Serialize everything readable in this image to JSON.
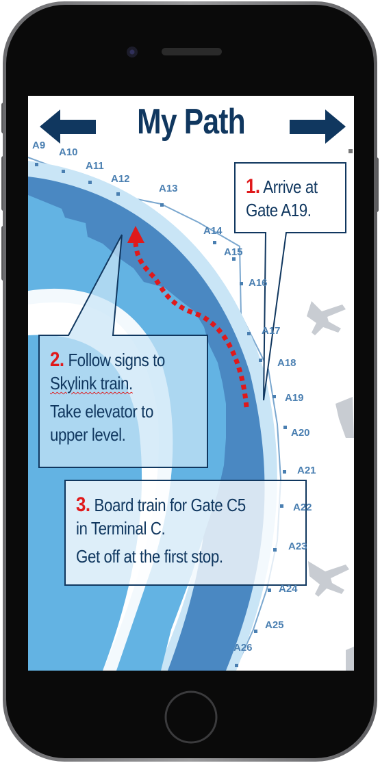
{
  "screen": {
    "title": "My Path",
    "nav": {
      "back": "left-arrow-icon",
      "forward": "right-arrow-icon"
    },
    "gates": [
      "A9",
      "A10",
      "A11",
      "A12",
      "A13",
      "A14",
      "A15",
      "A16",
      "A17",
      "A18",
      "A19",
      "A20",
      "A21",
      "A22",
      "A23",
      "A24",
      "A25",
      "A26"
    ],
    "steps": [
      {
        "number": "1.",
        "lines": [
          "Arrive at",
          "Gate A19."
        ]
      },
      {
        "number": "2.",
        "lines": [
          "Follow signs to",
          "Skylink train.",
          "Take elevator to",
          "upper level."
        ]
      },
      {
        "number": "3.",
        "lines": [
          "Board train for Gate C5",
          "in Terminal C.",
          "Get off at the first stop."
        ]
      }
    ],
    "colors": {
      "title": "#10375f",
      "step_number": "#e0191b",
      "route": "#e0191b",
      "terminal_dark": "#4a88c2",
      "terminal_mid": "#63b3e3",
      "terminal_light": "#c9e5f6"
    }
  }
}
